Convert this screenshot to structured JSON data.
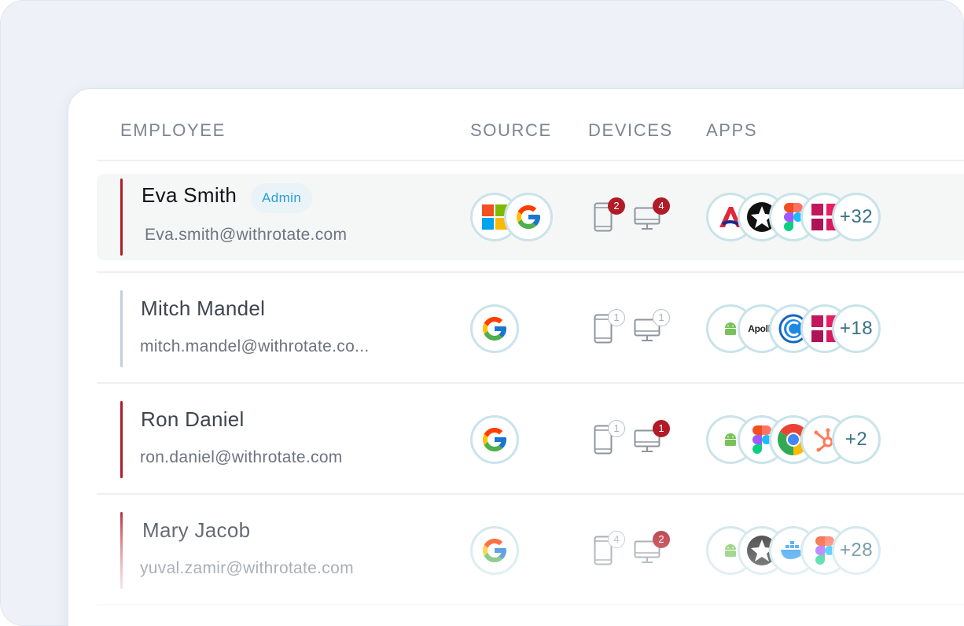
{
  "header": {
    "employee": "EMPLOYEE",
    "source": "SOURCE",
    "devices": "DEVICES",
    "apps": "APPS"
  },
  "colors": {
    "risk_high": "#b11b28",
    "risk_low": "#c5cedb",
    "badge_text": "#2a9fd6",
    "more_text": "#3a7286"
  },
  "rows": [
    {
      "name": "Eva Smith",
      "badge": "Admin",
      "email": "Eva.smith@withrotate.com",
      "sources": [
        "microsoft-icon",
        "google-icon"
      ],
      "devices": {
        "mobile": "2",
        "desktop": "4"
      },
      "apps": [
        "asana-icon",
        "star-app-icon",
        "figma-icon",
        "grid-app-icon"
      ],
      "more_apps": "+32"
    },
    {
      "name": "Mitch Mandel",
      "email": "mitch.mandel@withrotate.co...",
      "sources": [
        "google-icon"
      ],
      "devices": {
        "mobile": "1",
        "desktop": "1"
      },
      "apps": [
        "android-icon",
        "apollo-icon",
        "circle-c-icon",
        "grid-app-icon"
      ],
      "apollo_label": "Apollo",
      "more_apps": "+18"
    },
    {
      "name": "Ron Daniel",
      "email": "ron.daniel@withrotate.com",
      "sources": [
        "google-icon"
      ],
      "devices": {
        "mobile": "1",
        "desktop": "1"
      },
      "apps": [
        "android-icon",
        "figma-icon",
        "chrome-icon",
        "hubspot-icon"
      ],
      "more_apps": "+2"
    },
    {
      "name": "Mary Jacob",
      "email": "yuval.zamir@withrotate.com",
      "sources": [
        "google-icon"
      ],
      "devices": {
        "mobile": "4",
        "desktop": "2"
      },
      "apps": [
        "android-icon",
        "star-app-icon",
        "docker-icon",
        "figma-icon"
      ],
      "more_apps": "+28"
    }
  ]
}
